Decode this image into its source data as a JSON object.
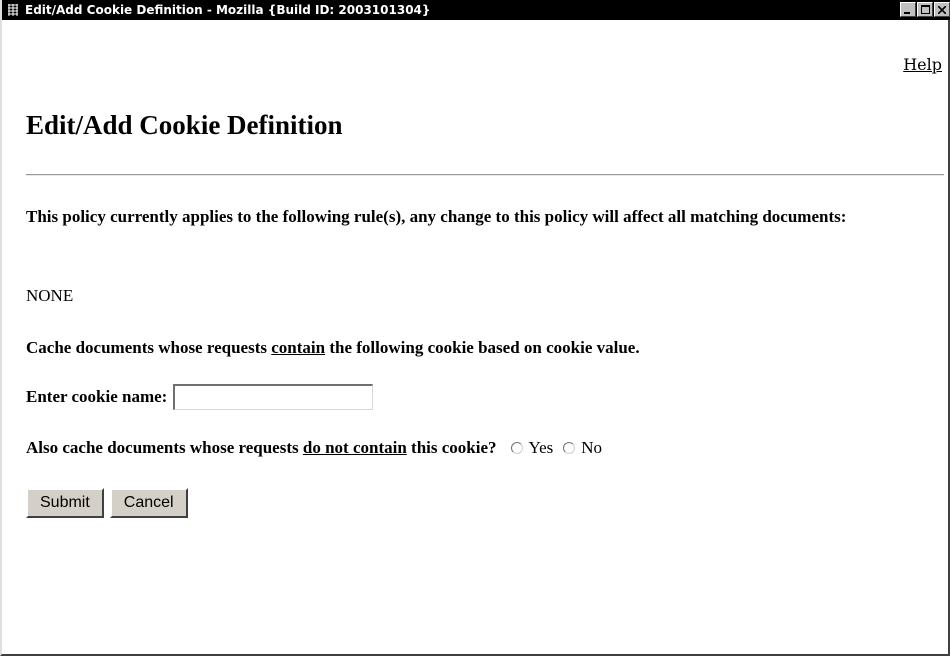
{
  "window": {
    "title": "Edit/Add Cookie Definition - Mozilla {Build ID: 2003101304}",
    "controls": [
      "minimize",
      "maximize",
      "close"
    ]
  },
  "page": {
    "help_link": "Help",
    "title": "Edit/Add Cookie Definition",
    "policy_text": "This policy currently applies to the following rule(s), any change to this policy will affect all matching documents:",
    "rules_value": "NONE",
    "cache_text_before": "Cache documents whose requests ",
    "cache_text_underlined": "contain",
    "cache_text_after": " the following cookie based on cookie value.",
    "cookie_name_label": "Enter cookie name:",
    "cookie_name_value": "",
    "also_text_before": "Also cache documents whose requests ",
    "also_text_underlined": "do not contain",
    "also_text_after": " this cookie?",
    "radio_yes_label": "Yes",
    "radio_no_label": "No",
    "submit_label": "Submit",
    "cancel_label": "Cancel"
  },
  "colors": {
    "titlebar_bg": "#000000",
    "titlebar_text": "#ffffff",
    "button_face": "#d4d0c8",
    "page_bg": "#ffffff"
  },
  "icons": {
    "app": "mozilla-window-icon",
    "minimize": "minimize-icon",
    "maximize": "maximize-icon",
    "close": "close-icon"
  }
}
